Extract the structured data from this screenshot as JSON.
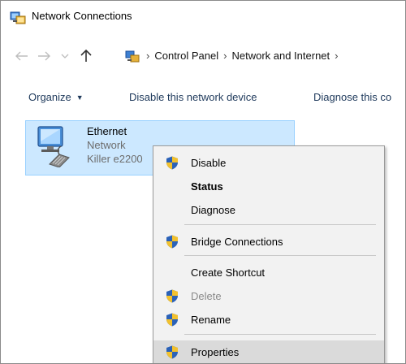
{
  "window": {
    "title": "Network Connections"
  },
  "address": {
    "crumbs": [
      "Control Panel",
      "Network and Internet"
    ],
    "sep": "›"
  },
  "toolbar": {
    "organize": "Organize",
    "disable": "Disable this network device",
    "diagnose": "Diagnose this co"
  },
  "connection": {
    "name": "Ethernet",
    "status": "Network",
    "adapter": "Killer e2200"
  },
  "context_menu": {
    "items": [
      {
        "label": "Disable",
        "shield": true
      },
      {
        "label": "Status",
        "bold": true
      },
      {
        "label": "Diagnose"
      },
      {
        "label": "Bridge Connections",
        "shield": true
      },
      {
        "label": "Create Shortcut"
      },
      {
        "label": "Delete",
        "shield": true,
        "disabled": true
      },
      {
        "label": "Rename",
        "shield": true
      },
      {
        "label": "Properties",
        "shield": true,
        "highlighted": true
      }
    ]
  },
  "colors": {
    "selection_bg": "#cce8ff",
    "selection_border": "#99d1ff",
    "menu_bg": "#f2f2f2",
    "menu_highlight": "#dadada",
    "toolbar_text": "#1e395b",
    "shield_blue": "#2b62b8",
    "shield_yellow": "#f2c12e"
  },
  "icons": {
    "title": "network-connections-icon",
    "back": "back-arrow-icon",
    "forward": "forward-arrow-icon",
    "recent": "chevron-down-icon",
    "up": "up-arrow-icon",
    "shield": "uac-shield-icon",
    "ethernet": "ethernet-adapter-icon"
  }
}
